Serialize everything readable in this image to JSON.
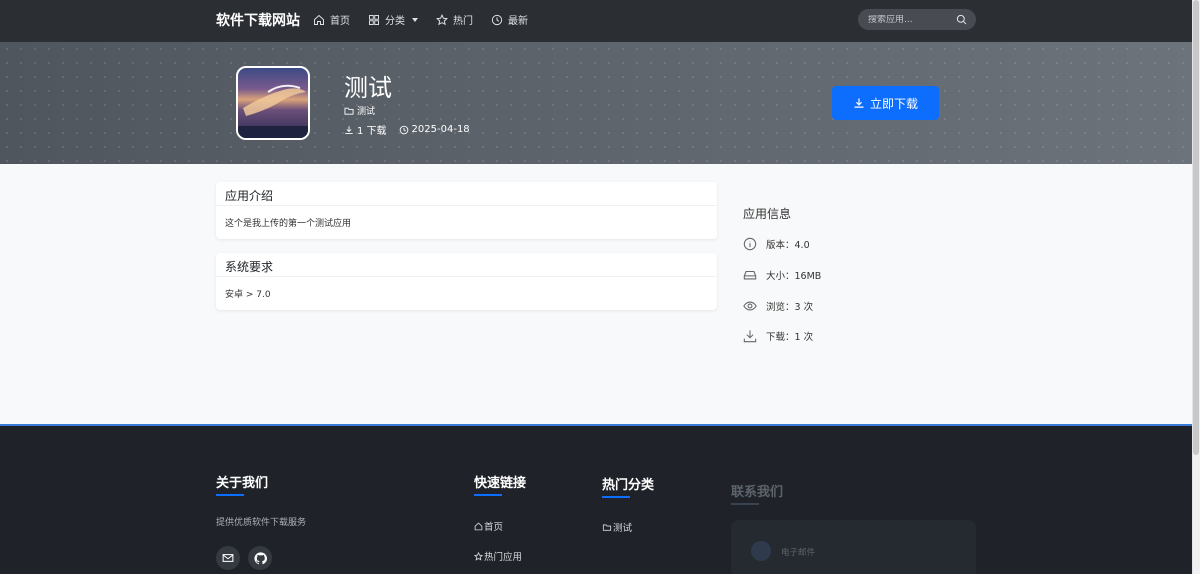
{
  "header": {
    "brand": "软件下载网站",
    "nav": [
      {
        "icon": "home-icon",
        "label": "首页"
      },
      {
        "icon": "grid-icon",
        "label": "分类"
      },
      {
        "icon": "star-icon",
        "label": "热门"
      },
      {
        "icon": "clock-icon",
        "label": "最新"
      }
    ],
    "search_placeholder": "搜索应用..."
  },
  "app": {
    "name": "测试",
    "category": "测试",
    "downloads": "1 下载",
    "date": "2025-04-18",
    "download_button": "立即下载"
  },
  "intro": {
    "title": "应用介绍",
    "text": "这个是我上传的第一个测试应用"
  },
  "requirements": {
    "title": "系统要求",
    "text": "安卓 > 7.0"
  },
  "info": {
    "title": "应用信息",
    "rows": [
      {
        "icon": "info-icon",
        "label": "版本：4.0"
      },
      {
        "icon": "hdd-icon",
        "label": "大小：16MB"
      },
      {
        "icon": "eye-icon",
        "label": "浏览：3 次"
      },
      {
        "icon": "download-icon",
        "label": "下载：1 次"
      }
    ]
  },
  "footer": {
    "about_title": "关于我们",
    "about_text": "提供优质软件下载服务",
    "links_title": "快速链接",
    "links": [
      "首页",
      "热门应用"
    ],
    "hot_title": "热门分类",
    "hot_cats": [
      "测试"
    ],
    "contact_title": "联系我们",
    "contact_email_label": "电子邮件"
  },
  "colors": {
    "accent": "#0d6efd",
    "navbar": "#2b2e33",
    "footer": "#1f2329"
  }
}
